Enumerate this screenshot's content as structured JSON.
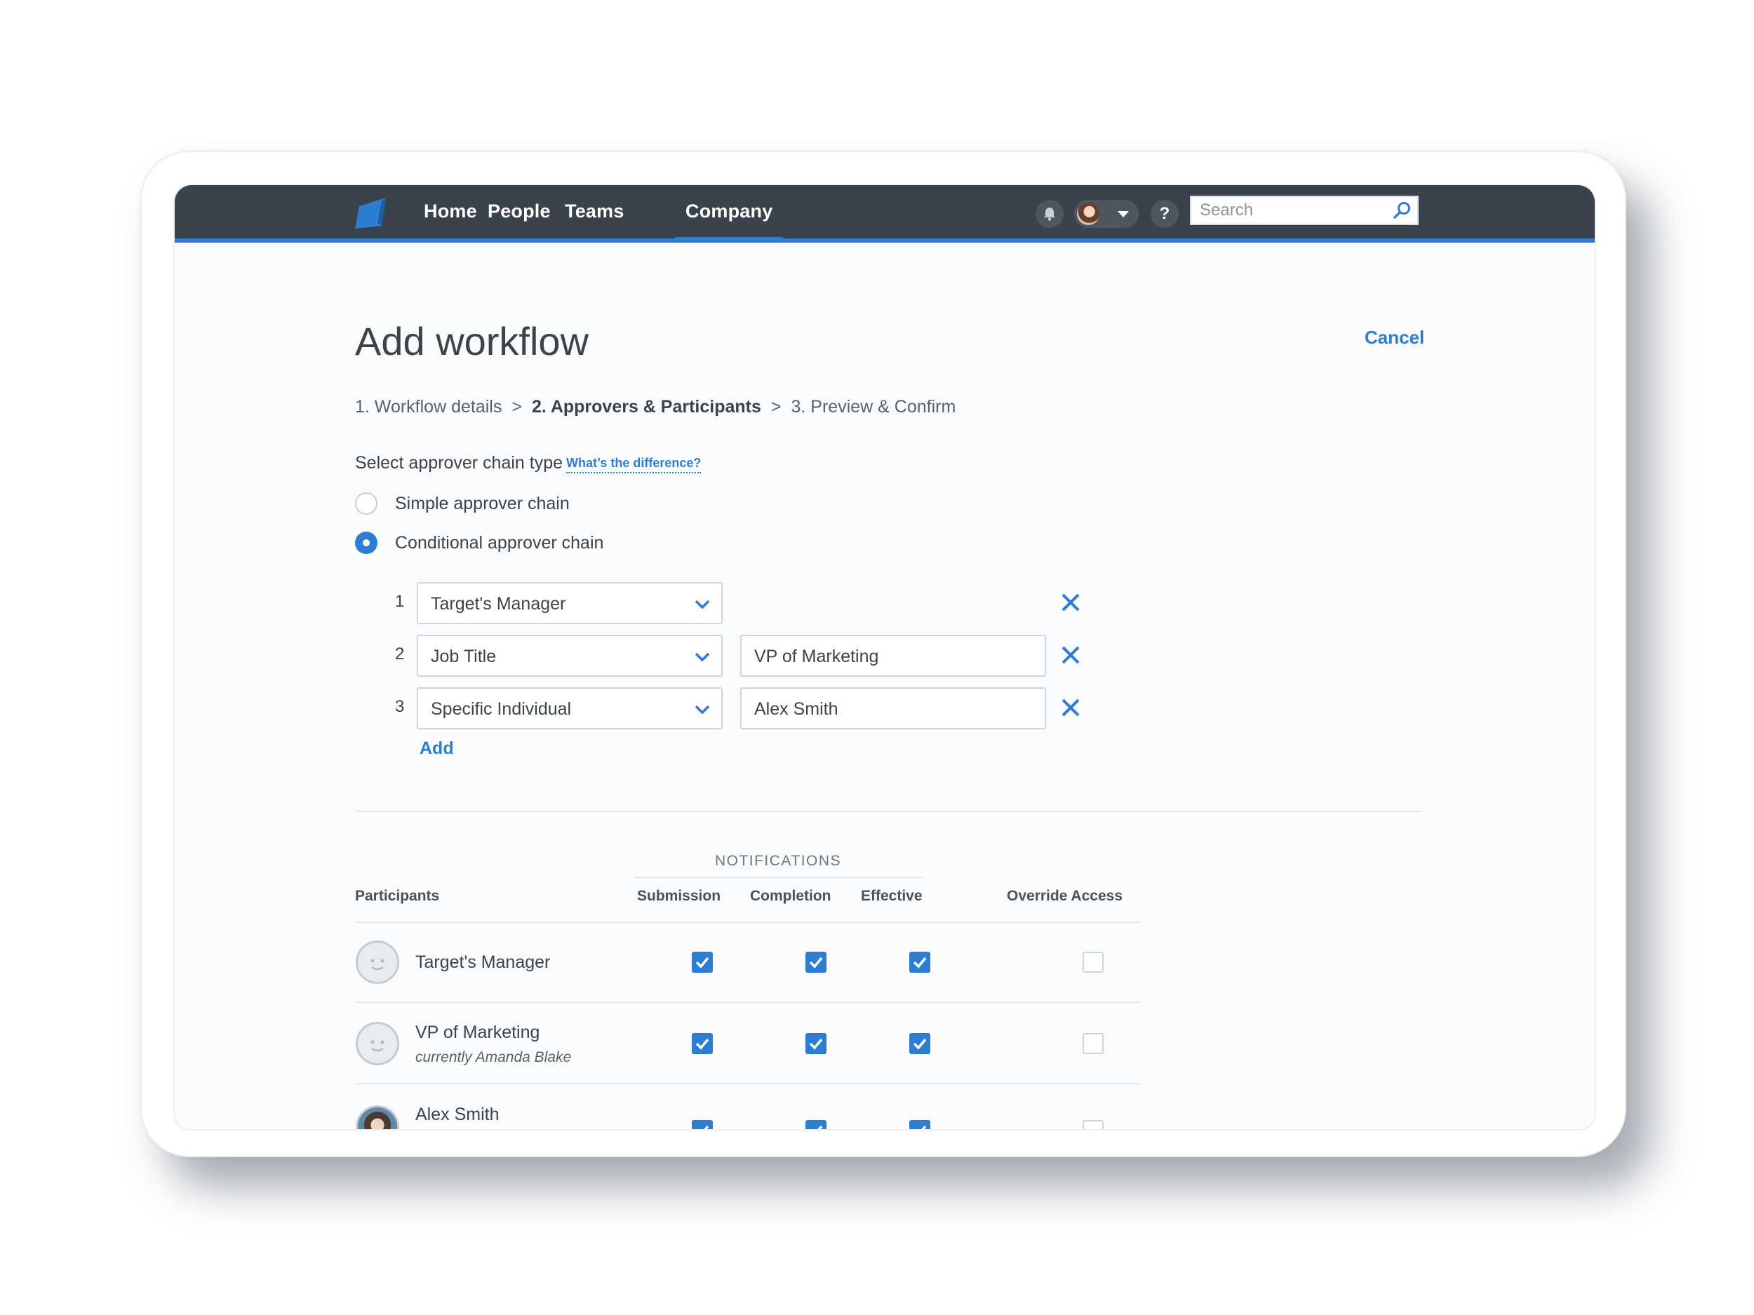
{
  "nav": {
    "items": [
      {
        "label": "Home"
      },
      {
        "label": "People"
      },
      {
        "label": "Teams"
      },
      {
        "label": "Company",
        "active": true
      }
    ],
    "help_label": "?",
    "search_placeholder": "Search"
  },
  "page": {
    "title": "Add workflow",
    "cancel_label": "Cancel"
  },
  "breadcrumb": {
    "steps": [
      "1. Workflow details",
      "2. Approvers & Participants",
      "3. Preview & Confirm"
    ],
    "separator": ">",
    "current_index": 1
  },
  "approver_chain": {
    "label": "Select approver chain type",
    "help_link": "What’s the difference?",
    "options": [
      {
        "label": "Simple approver chain",
        "selected": false
      },
      {
        "label": "Conditional approver chain",
        "selected": true
      }
    ],
    "approvers": [
      {
        "number": "1",
        "type": "Target's Manager",
        "value": ""
      },
      {
        "number": "2",
        "type": "Job Title",
        "value": "VP of Marketing"
      },
      {
        "number": "3",
        "type": "Specific Individual",
        "value": "Alex Smith"
      }
    ],
    "add_label": "Add"
  },
  "participants": {
    "notifications_heading": "NOTIFICATIONS",
    "columns": [
      "Participants",
      "Submission",
      "Completion",
      "Effective",
      "Override Access"
    ],
    "rows": [
      {
        "name": "Target's Manager",
        "subtitle": "",
        "submission": true,
        "completion": true,
        "effective": true,
        "override": false
      },
      {
        "name": "VP of Marketing",
        "subtitle": "currently Amanda Blake",
        "submission": true,
        "completion": true,
        "effective": true,
        "override": false
      },
      {
        "name": "Alex Smith",
        "subtitle": "",
        "submission": true,
        "completion": true,
        "effective": true,
        "override": false
      }
    ]
  },
  "colors": {
    "nav_bg": "#3a424c",
    "accent": "#2d7dd2",
    "page_bg": "#fafbfc"
  }
}
